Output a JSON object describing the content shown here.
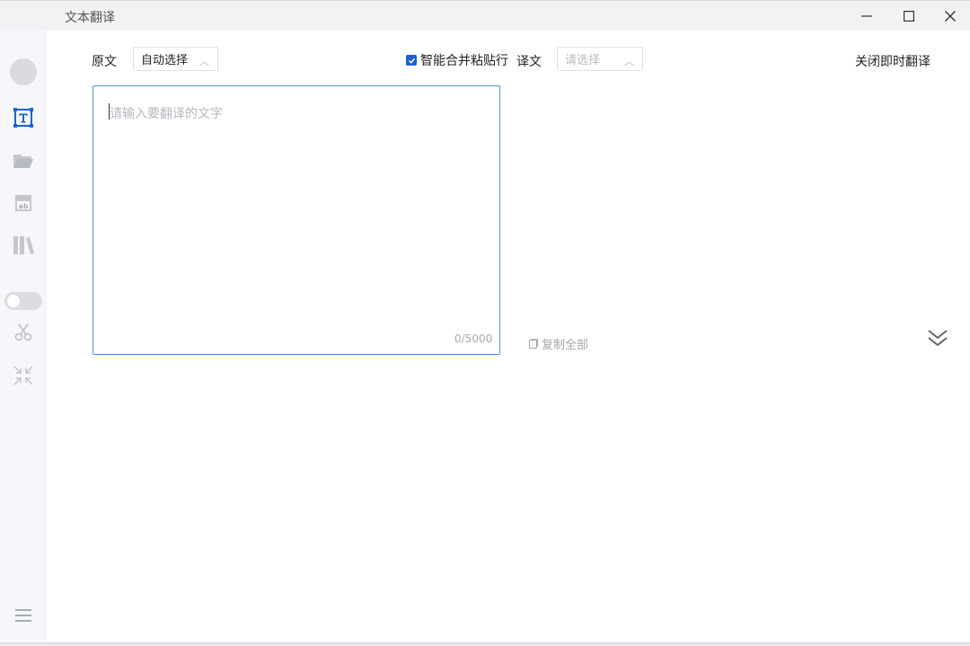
{
  "window": {
    "title": "文本翻译"
  },
  "sidebar": {
    "items": [
      {
        "name": "avatar"
      },
      {
        "name": "text-translate-icon",
        "active": true
      },
      {
        "name": "folder-icon"
      },
      {
        "name": "document-translate-icon"
      },
      {
        "name": "library-icon"
      },
      {
        "name": "toggle"
      },
      {
        "name": "scissors-icon"
      },
      {
        "name": "shrink-icon"
      },
      {
        "name": "menu-icon"
      }
    ]
  },
  "toolbar": {
    "source_label": "原文",
    "source_select_value": "自动选择",
    "smart_merge_label": "智能合并粘贴行",
    "smart_merge_checked": true,
    "target_label": "译文",
    "target_select_placeholder": "请选择",
    "close_instant_label": "关闭即时翻译"
  },
  "editor": {
    "placeholder": "请输入要翻译的文字",
    "value": "",
    "counter": "0/5000"
  },
  "result": {
    "copy_all_label": "复制全部"
  },
  "colors": {
    "accent": "#1a62d9",
    "editor_border": "#4a90e2",
    "sidebar_bg": "#f6f7fb",
    "titlebar_bg": "#f1f2f4"
  }
}
